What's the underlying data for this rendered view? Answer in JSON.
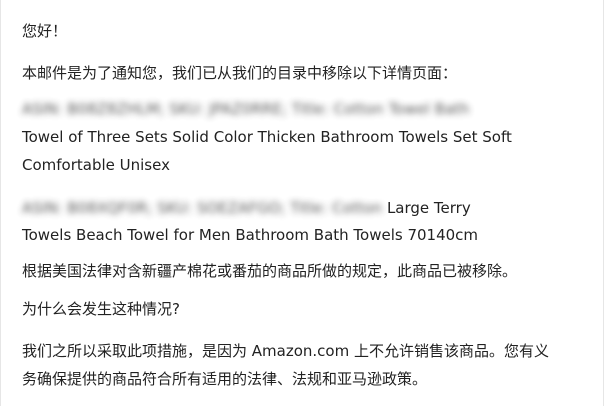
{
  "email": {
    "greeting": "您好！",
    "intro": "本邮件是为了通知您，我们已从我们的目录中移除以下详情页面：",
    "item1": {
      "redacted_prefix": "ASIN: B08Z8ZHLM; SKU: JPAZ0RRE; Title: Cotton Towel Bath",
      "line2": "Towel of Three Sets Solid Color Thicken Bathroom Towels Set Soft",
      "line3": "Comfortable Unisex"
    },
    "item2": {
      "redacted_prefix": "ASIN: B08XQF0R; SKU: SOEZAFGO; Title: Cotton",
      "visible_suffix": "Large Terry",
      "line2": "Towels Beach Towel for Men Bathroom Bath Towels 70140cm"
    },
    "reason": "根据美国法律对含新疆产棉花或番茄的商品所做的规定，此商品已被移除。",
    "question": "为什么会发生这种情况?",
    "explanation1": "我们之所以采取此项措施，是因为 Amazon.com 上不允许销售该商品。您有义",
    "explanation2": "务确保提供的商品符合所有适用的法律、法规和亚马逊政策。"
  }
}
